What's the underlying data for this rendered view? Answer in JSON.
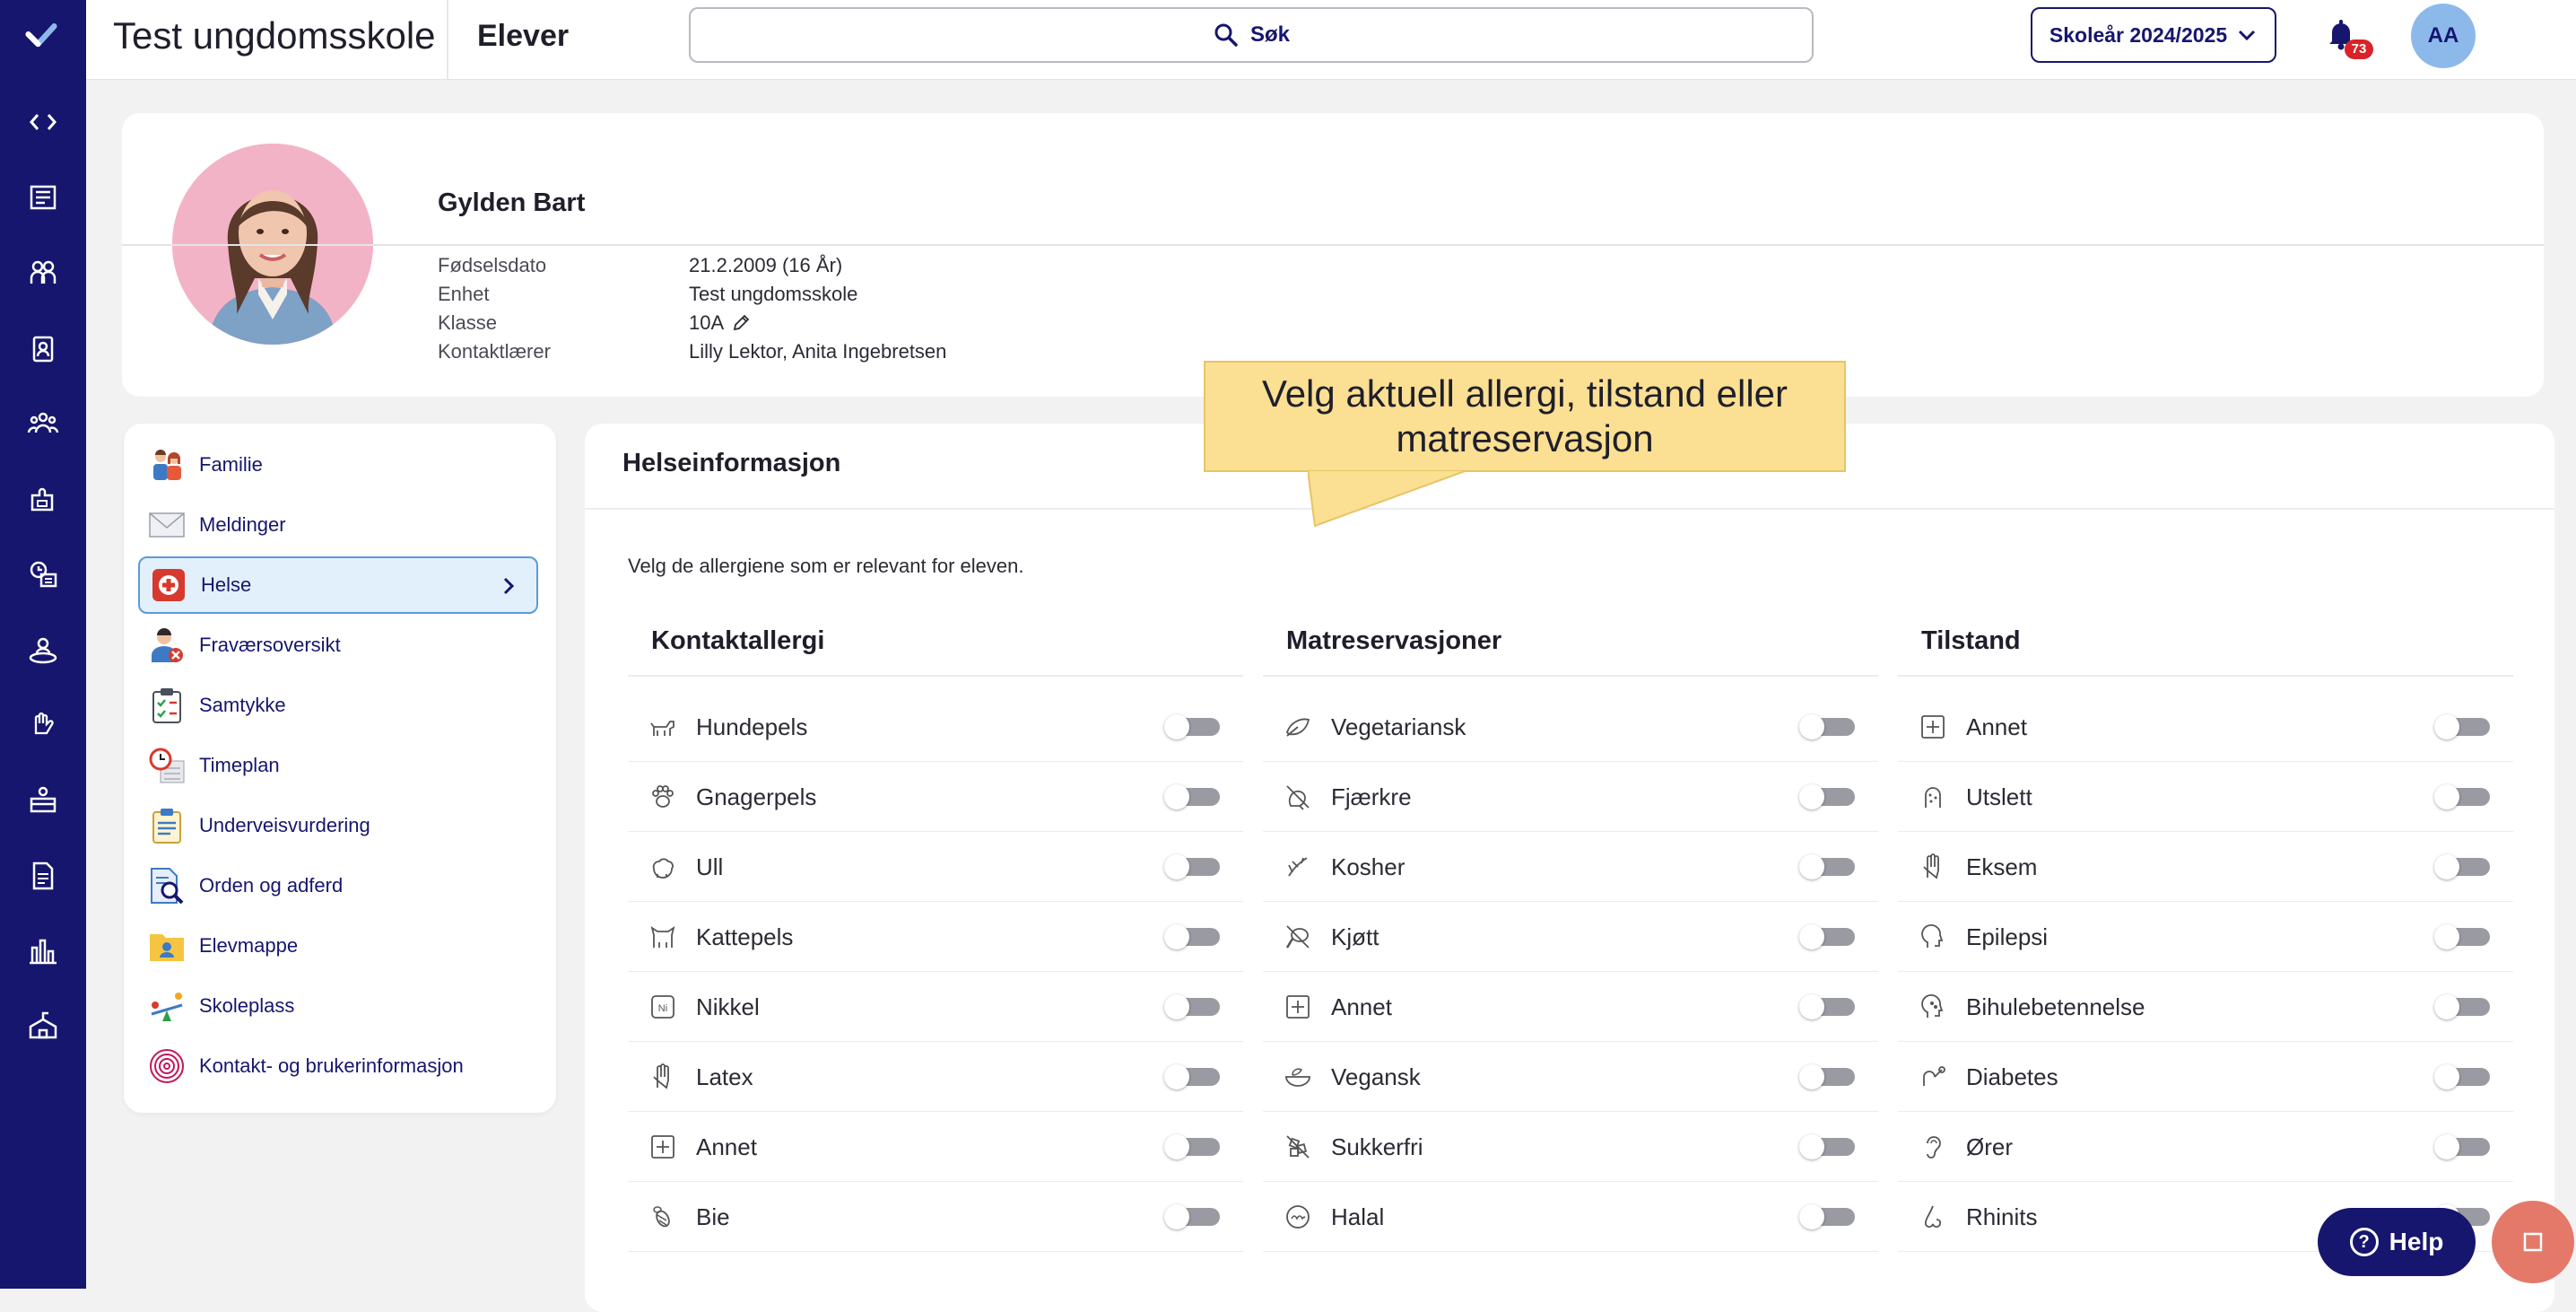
{
  "header": {
    "app_title": "Test ungdomsskole",
    "section": "Elever",
    "search_label": "Søk",
    "school_year": "Skoleår 2024/2025",
    "notification_count": "73",
    "user_initials": "AA"
  },
  "rail_icons": [
    "collapse-icon",
    "news-icon",
    "group-icon",
    "id-badge-icon",
    "people-icon",
    "puzzle-icon",
    "schedule-icon",
    "person-circle-icon",
    "hand-icon",
    "desk-icon",
    "document-icon",
    "bar-chart-icon",
    "school-icon"
  ],
  "student": {
    "name": "Gylden Bart",
    "fields": [
      {
        "label": "Fødselsdato",
        "value": "21.2.2009 (16 År)"
      },
      {
        "label": "Enhet",
        "value": "Test ungdomsskole"
      },
      {
        "label": "Klasse",
        "value": "10A"
      },
      {
        "label": "Kontaktlærer",
        "value": "Lilly Lektor, Anita Ingebretsen"
      }
    ]
  },
  "menu": [
    {
      "label": "Familie",
      "icon": "family-icon"
    },
    {
      "label": "Meldinger",
      "icon": "envelope-icon"
    },
    {
      "label": "Helse",
      "icon": "health-cross-icon",
      "active": true
    },
    {
      "label": "Fraværsoversikt",
      "icon": "absence-icon"
    },
    {
      "label": "Samtykke",
      "icon": "clipboard-check-icon"
    },
    {
      "label": "Timeplan",
      "icon": "clock-calendar-icon"
    },
    {
      "label": "Underveisvurdering",
      "icon": "clipboard-list-icon"
    },
    {
      "label": "Orden og adferd",
      "icon": "document-search-icon"
    },
    {
      "label": "Elevmappe",
      "icon": "folder-person-icon"
    },
    {
      "label": "Skoleplass",
      "icon": "seesaw-icon"
    },
    {
      "label": "Kontakt- og brukerinformasjon",
      "icon": "fingerprint-icon"
    }
  ],
  "panel": {
    "title": "Helseinformasjon",
    "description": "Velg de allergiene som er relevant for eleven."
  },
  "columns": [
    {
      "title": "Kontaktallergi",
      "items": [
        {
          "label": "Hundepels",
          "icon": "dog-icon"
        },
        {
          "label": "Gnagerpels",
          "icon": "paw-icon"
        },
        {
          "label": "Ull",
          "icon": "sheep-icon"
        },
        {
          "label": "Kattepels",
          "icon": "cat-icon"
        },
        {
          "label": "Nikkel",
          "icon": "nickel-icon"
        },
        {
          "label": "Latex",
          "icon": "glove-icon"
        },
        {
          "label": "Annet",
          "icon": "plus-box-icon"
        },
        {
          "label": "Bie",
          "icon": "bee-icon"
        }
      ]
    },
    {
      "title": "Matreservasjoner",
      "items": [
        {
          "label": "Vegetariansk",
          "icon": "leaf-icon"
        },
        {
          "label": "Fjærkre",
          "icon": "no-poultry-icon"
        },
        {
          "label": "Kosher",
          "icon": "kosher-icon"
        },
        {
          "label": "Kjøtt",
          "icon": "no-meat-icon"
        },
        {
          "label": "Annet",
          "icon": "plus-box-icon"
        },
        {
          "label": "Vegansk",
          "icon": "bowl-icon"
        },
        {
          "label": "Sukkerfri",
          "icon": "no-sugar-icon"
        },
        {
          "label": "Halal",
          "icon": "halal-icon"
        }
      ]
    },
    {
      "title": "Tilstand",
      "items": [
        {
          "label": "Annet",
          "icon": "plus-box-icon"
        },
        {
          "label": "Utslett",
          "icon": "rash-icon"
        },
        {
          "label": "Eksem",
          "icon": "hand-icon"
        },
        {
          "label": "Epilepsi",
          "icon": "head-icon"
        },
        {
          "label": "Bihulebetennelse",
          "icon": "sinus-icon"
        },
        {
          "label": "Diabetes",
          "icon": "glucose-icon"
        },
        {
          "label": "Ører",
          "icon": "ear-icon"
        },
        {
          "label": "Rhinits",
          "icon": "nose-icon"
        }
      ]
    }
  ],
  "callout": {
    "text": "Velg aktuell allergi, tilstand eller matreservasjon"
  },
  "help": {
    "label": "Help"
  }
}
